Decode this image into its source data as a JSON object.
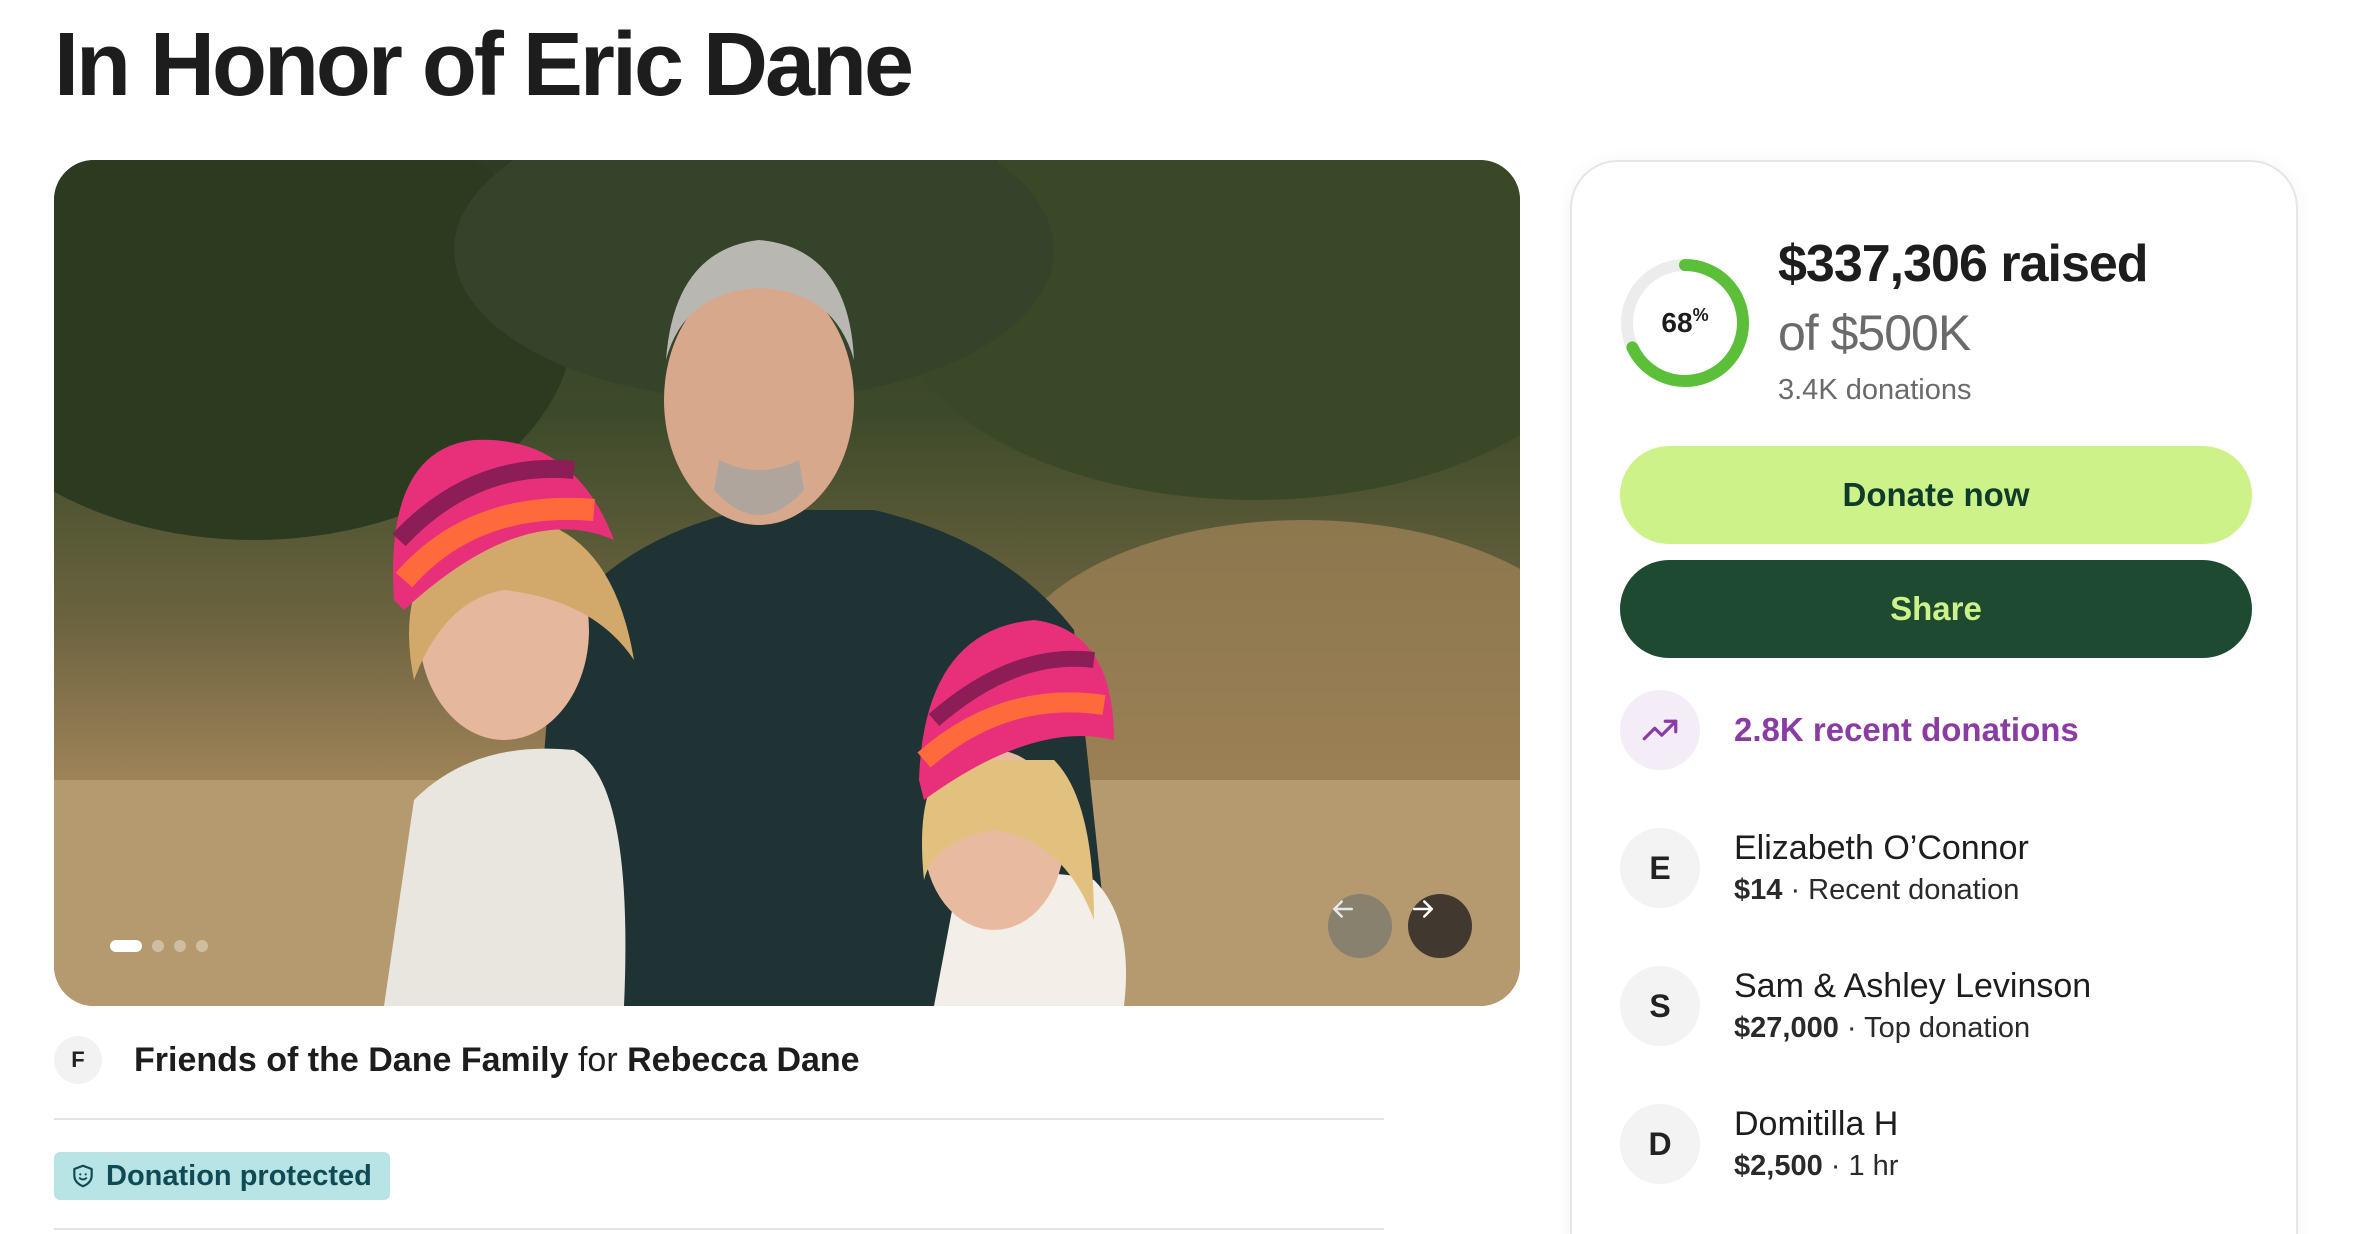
{
  "page": {
    "title": "In Honor of Eric Dane"
  },
  "hero": {
    "slide_count": 1
  },
  "organizer": {
    "avatar_initial": "F",
    "name": "Friends of the Dane Family",
    "connector": "for",
    "beneficiary": "Rebecca Dane"
  },
  "badge": {
    "label": "Donation protected",
    "icon": "shield-icon"
  },
  "fundraiser": {
    "percent_label": "68",
    "percent_suffix": "%",
    "progress_fraction": 0.68,
    "raised": "$337,306 raised",
    "goal": "of $500K",
    "donations_count": "3.4K donations",
    "donate_label": "Donate now",
    "share_label": "Share",
    "recent_label": "2.8K recent donations",
    "donors": [
      {
        "initial": "E",
        "name": "Elizabeth O’Connor",
        "amount": "$14",
        "detail": "Recent donation"
      },
      {
        "initial": "S",
        "name": "Sam & Ashley Levinson",
        "amount": "$27,000",
        "detail": "Top donation"
      },
      {
        "initial": "D",
        "name": "Domitilla H",
        "amount": "$2,500",
        "detail": "1 hr"
      }
    ]
  },
  "colors": {
    "donate_bg": "#cdf28a",
    "share_bg": "#1f4a32",
    "accent_purple": "#8a3ba4",
    "progress_green": "#5bbf3a",
    "badge_bg": "#b8e4e6"
  }
}
